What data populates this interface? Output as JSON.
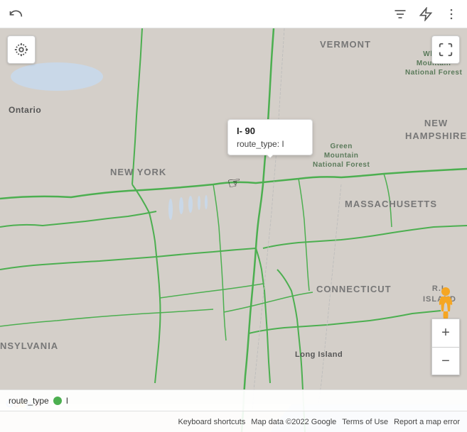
{
  "toolbar": {
    "undo_label": "↩",
    "filter_icon": "≡",
    "lightning_icon": "⚡",
    "more_icon": "⋮"
  },
  "map": {
    "tooltip": {
      "title": "I- 90",
      "route_label": "route_type:",
      "route_value": "I"
    },
    "labels": {
      "vermont": "VERMONT",
      "new_hampshire": "NEW\nHAMPSHIRE",
      "new_york": "NEW YORK",
      "massachusetts": "MASSACHUSETTS",
      "connecticut": "CONNECTICUT",
      "ontario": "Ontario",
      "rhode_island": "R.I.\nISLAND",
      "pennsylvania": "NSYLVANIA",
      "long_island": "Long Island",
      "white_mountain": "White\nMountain\nNational Forest",
      "green_mountain": "Green\nMountain\nNational Forest"
    }
  },
  "controls": {
    "locate_icon": "◎",
    "fullscreen_expand": "⛶",
    "zoom_in": "+",
    "zoom_out": "−"
  },
  "bottom_bar": {
    "keyboard_shortcuts": "Keyboard shortcuts",
    "map_data": "Map data ©2022 Google",
    "terms": "Terms of Use",
    "report": "Report a map error"
  },
  "legend": {
    "label": "route_type",
    "dot_color": "#4caf50",
    "value": "I"
  }
}
